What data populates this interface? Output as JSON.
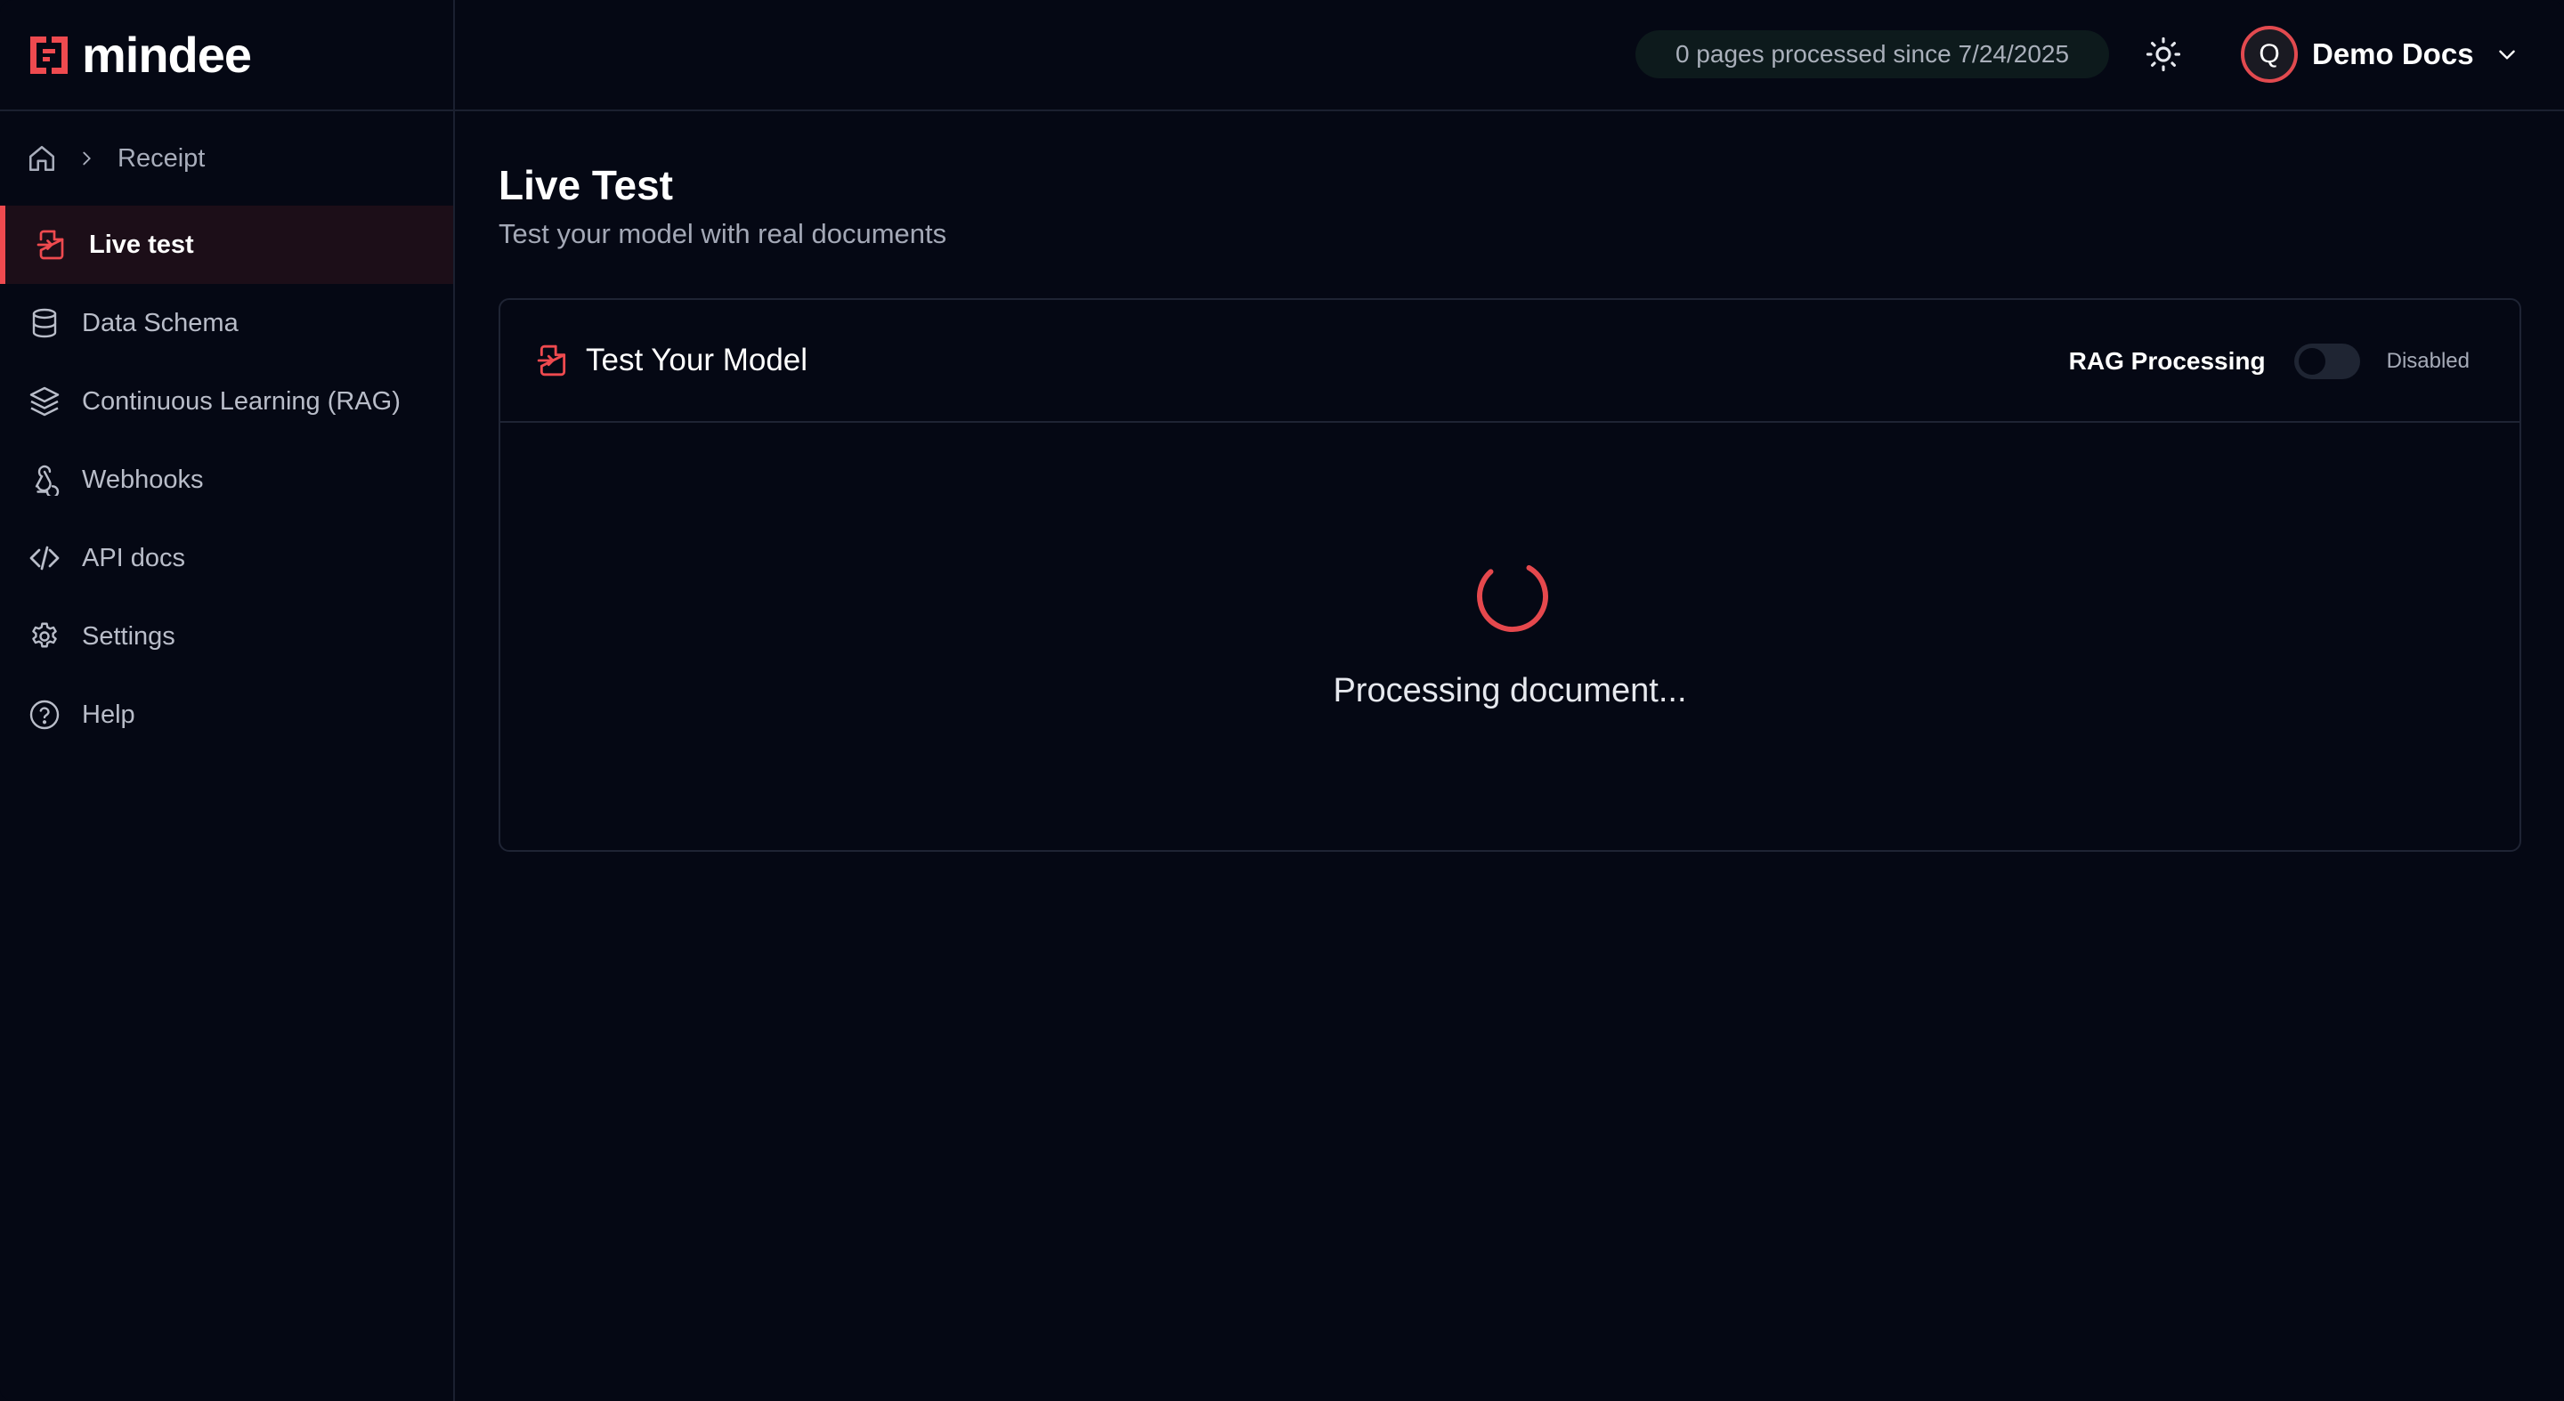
{
  "brand": {
    "name": "mindee",
    "accent": "#ef4a4f"
  },
  "breadcrumb": {
    "home_icon": "home-icon",
    "current": "Receipt"
  },
  "sidebar": {
    "items": [
      {
        "label": "Live test",
        "icon": "file-import-icon",
        "active": true
      },
      {
        "label": "Data Schema",
        "icon": "database-icon",
        "active": false
      },
      {
        "label": "Continuous Learning (RAG)",
        "icon": "layers-icon",
        "active": false
      },
      {
        "label": "Webhooks",
        "icon": "webhook-icon",
        "active": false
      },
      {
        "label": "API docs",
        "icon": "code-icon",
        "active": false
      },
      {
        "label": "Settings",
        "icon": "gear-icon",
        "active": false
      },
      {
        "label": "Help",
        "icon": "help-circle-icon",
        "active": false
      }
    ]
  },
  "topbar": {
    "usage": "0 pages processed since 7/24/2025",
    "theme_icon": "sun-icon",
    "user": {
      "initial": "Q",
      "name": "Demo Docs"
    }
  },
  "main": {
    "title": "Live Test",
    "subtitle": "Test your model with real documents",
    "card": {
      "title": "Test Your Model",
      "rag_label": "RAG Processing",
      "rag_state": "Disabled",
      "rag_enabled": false,
      "status": "Processing document..."
    }
  }
}
